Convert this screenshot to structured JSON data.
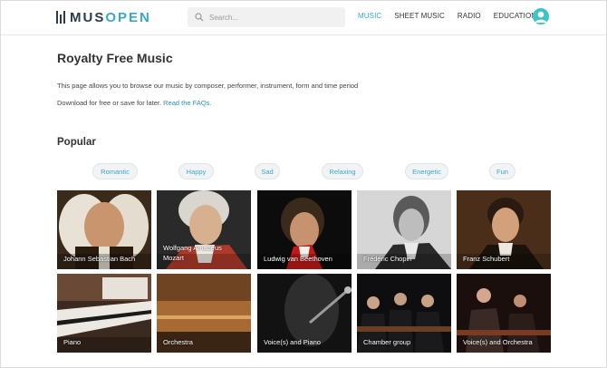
{
  "header": {
    "logo_left": "MUS",
    "logo_right": "OPEN",
    "search_placeholder": "Search...",
    "nav": [
      "MUSIC",
      "SHEET MUSIC",
      "RADIO",
      "EDUCATION"
    ],
    "active_nav": "MUSIC",
    "accent_color": "#3aa7c9"
  },
  "page": {
    "title": "Royalty Free Music",
    "intro": "This page allows you to browse our music by composer, performer, instrument, form and time period",
    "download_text": "Download for free or save for later.",
    "faq_link": "Read the FAQs."
  },
  "popular": {
    "title": "Popular",
    "moods": [
      "Romantic",
      "Happy",
      "Sad",
      "Relaxing",
      "Energetic",
      "Fun"
    ]
  },
  "tiles": {
    "composers": [
      "Johann Sebastian Bach",
      "Wolfgang Amadeus Mozart",
      "Ludwig van Beethoven",
      "Frédéric Chopin",
      "Franz Schubert"
    ],
    "instruments": [
      "Piano",
      "Orchestra",
      "Voice(s) and Piano",
      "Chamber group",
      "Voice(s) and Orchestra"
    ]
  }
}
